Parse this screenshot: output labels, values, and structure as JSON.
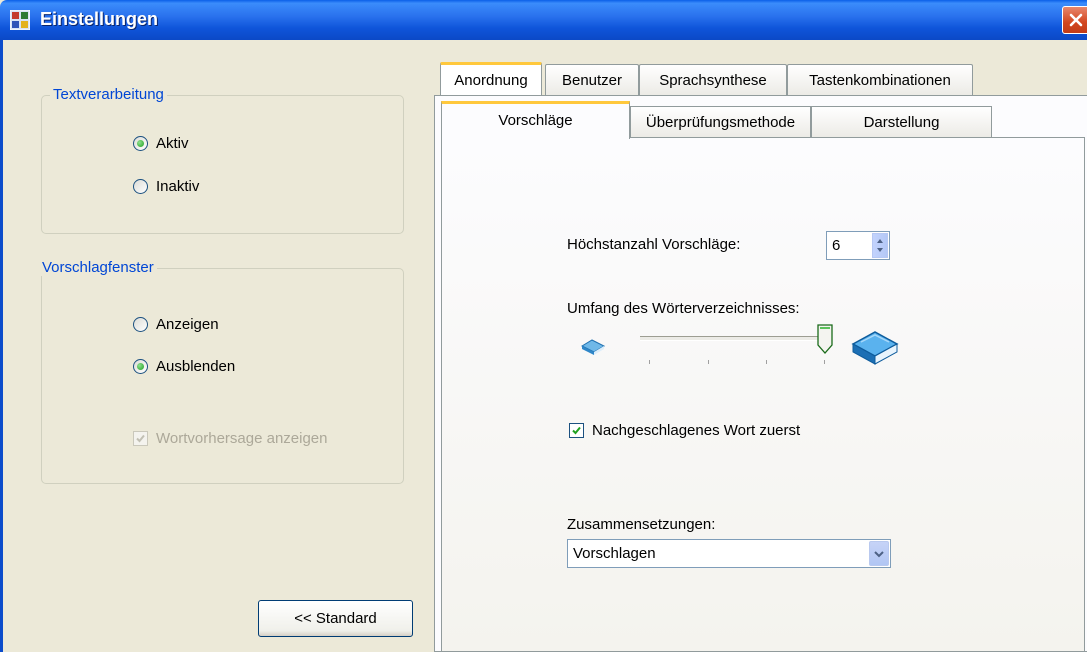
{
  "window": {
    "title": "Einstellungen"
  },
  "text_processing": {
    "legend": "Textverarbeitung",
    "options": [
      {
        "label": "Aktiv",
        "checked": true
      },
      {
        "label": "Inaktiv",
        "checked": false
      }
    ]
  },
  "suggestion_window": {
    "legend": "Vorschlagfenster",
    "options": [
      {
        "label": "Anzeigen",
        "checked": false
      },
      {
        "label": "Ausblenden",
        "checked": true
      }
    ],
    "word_prediction": {
      "label": "Wortvorhersage anzeigen",
      "checked": true,
      "enabled": false
    }
  },
  "buttons": {
    "standard": "<< Standard"
  },
  "tabs": [
    {
      "label": "Anordnung",
      "active": true
    },
    {
      "label": "Benutzer",
      "active": false
    },
    {
      "label": "Sprachsynthese",
      "active": false
    },
    {
      "label": "Tastenkombinationen",
      "active": false
    }
  ],
  "subtabs": [
    {
      "label": "Vorschläge",
      "active": true
    },
    {
      "label": "Überprüfungsmethode",
      "active": false
    },
    {
      "label": "Darstellung",
      "active": false
    }
  ],
  "suggestions": {
    "max_label": "Höchstanzahl Vorschläge:",
    "max_value": "6",
    "dictionary_label": "Umfang des Wörterverzeichnisses:",
    "dictionary_level": 1.0,
    "lookup_first": {
      "label": "Nachgeschlagenes Wort zuerst",
      "checked": true
    },
    "compounds_label": "Zusammensetzungen:",
    "compounds_value": "Vorschlagen"
  },
  "colors": {
    "titlebar": "#0B49C6",
    "legend": "#0046D5",
    "tab_highlight": "#FFC83C"
  }
}
